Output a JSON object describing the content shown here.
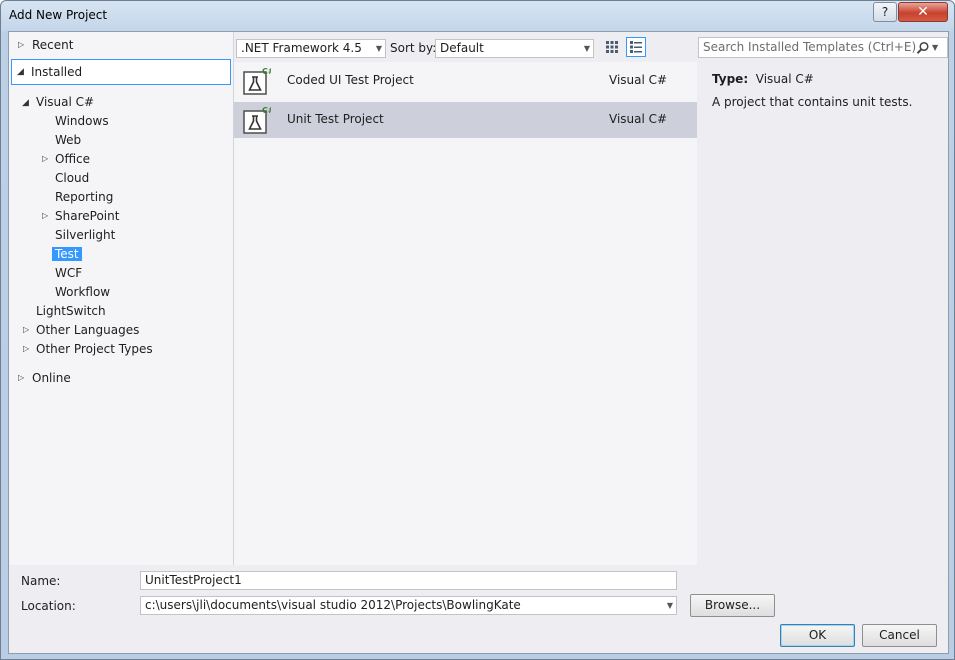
{
  "window": {
    "title": "Add New Project",
    "help": "?",
    "close": "✕"
  },
  "tree": {
    "recent": "Recent",
    "installed": "Installed",
    "visual_csharp": "Visual C#",
    "children": [
      "Windows",
      "Web",
      "Office",
      "Cloud",
      "Reporting",
      "SharePoint",
      "Silverlight",
      "Test",
      "WCF",
      "Workflow"
    ],
    "lightswitch": "LightSwitch",
    "other_languages": "Other Languages",
    "other_project_types": "Other Project Types",
    "online": "Online"
  },
  "toolbar": {
    "framework": ".NET Framework 4.5",
    "sort_label": "Sort by:",
    "sort_value": "Default",
    "search_placeholder": "Search Installed Templates (Ctrl+E)"
  },
  "templates": [
    {
      "name": "Coded UI Test Project",
      "lang": "Visual C#",
      "badge": "C#"
    },
    {
      "name": "Unit Test Project",
      "lang": "Visual C#",
      "badge": "C#"
    }
  ],
  "details": {
    "type_label": "Type:",
    "type_value": "Visual C#",
    "description": "A project that contains unit tests."
  },
  "form": {
    "name_label": "Name:",
    "name_value": "UnitTestProject1",
    "location_label": "Location:",
    "location_value": "c:\\users\\jli\\documents\\visual studio 2012\\Projects\\BowlingKate",
    "browse": "Browse...",
    "ok": "OK",
    "cancel": "Cancel"
  },
  "colors": {
    "selection": "#3399ff",
    "selected_row": "#cdd0db"
  }
}
